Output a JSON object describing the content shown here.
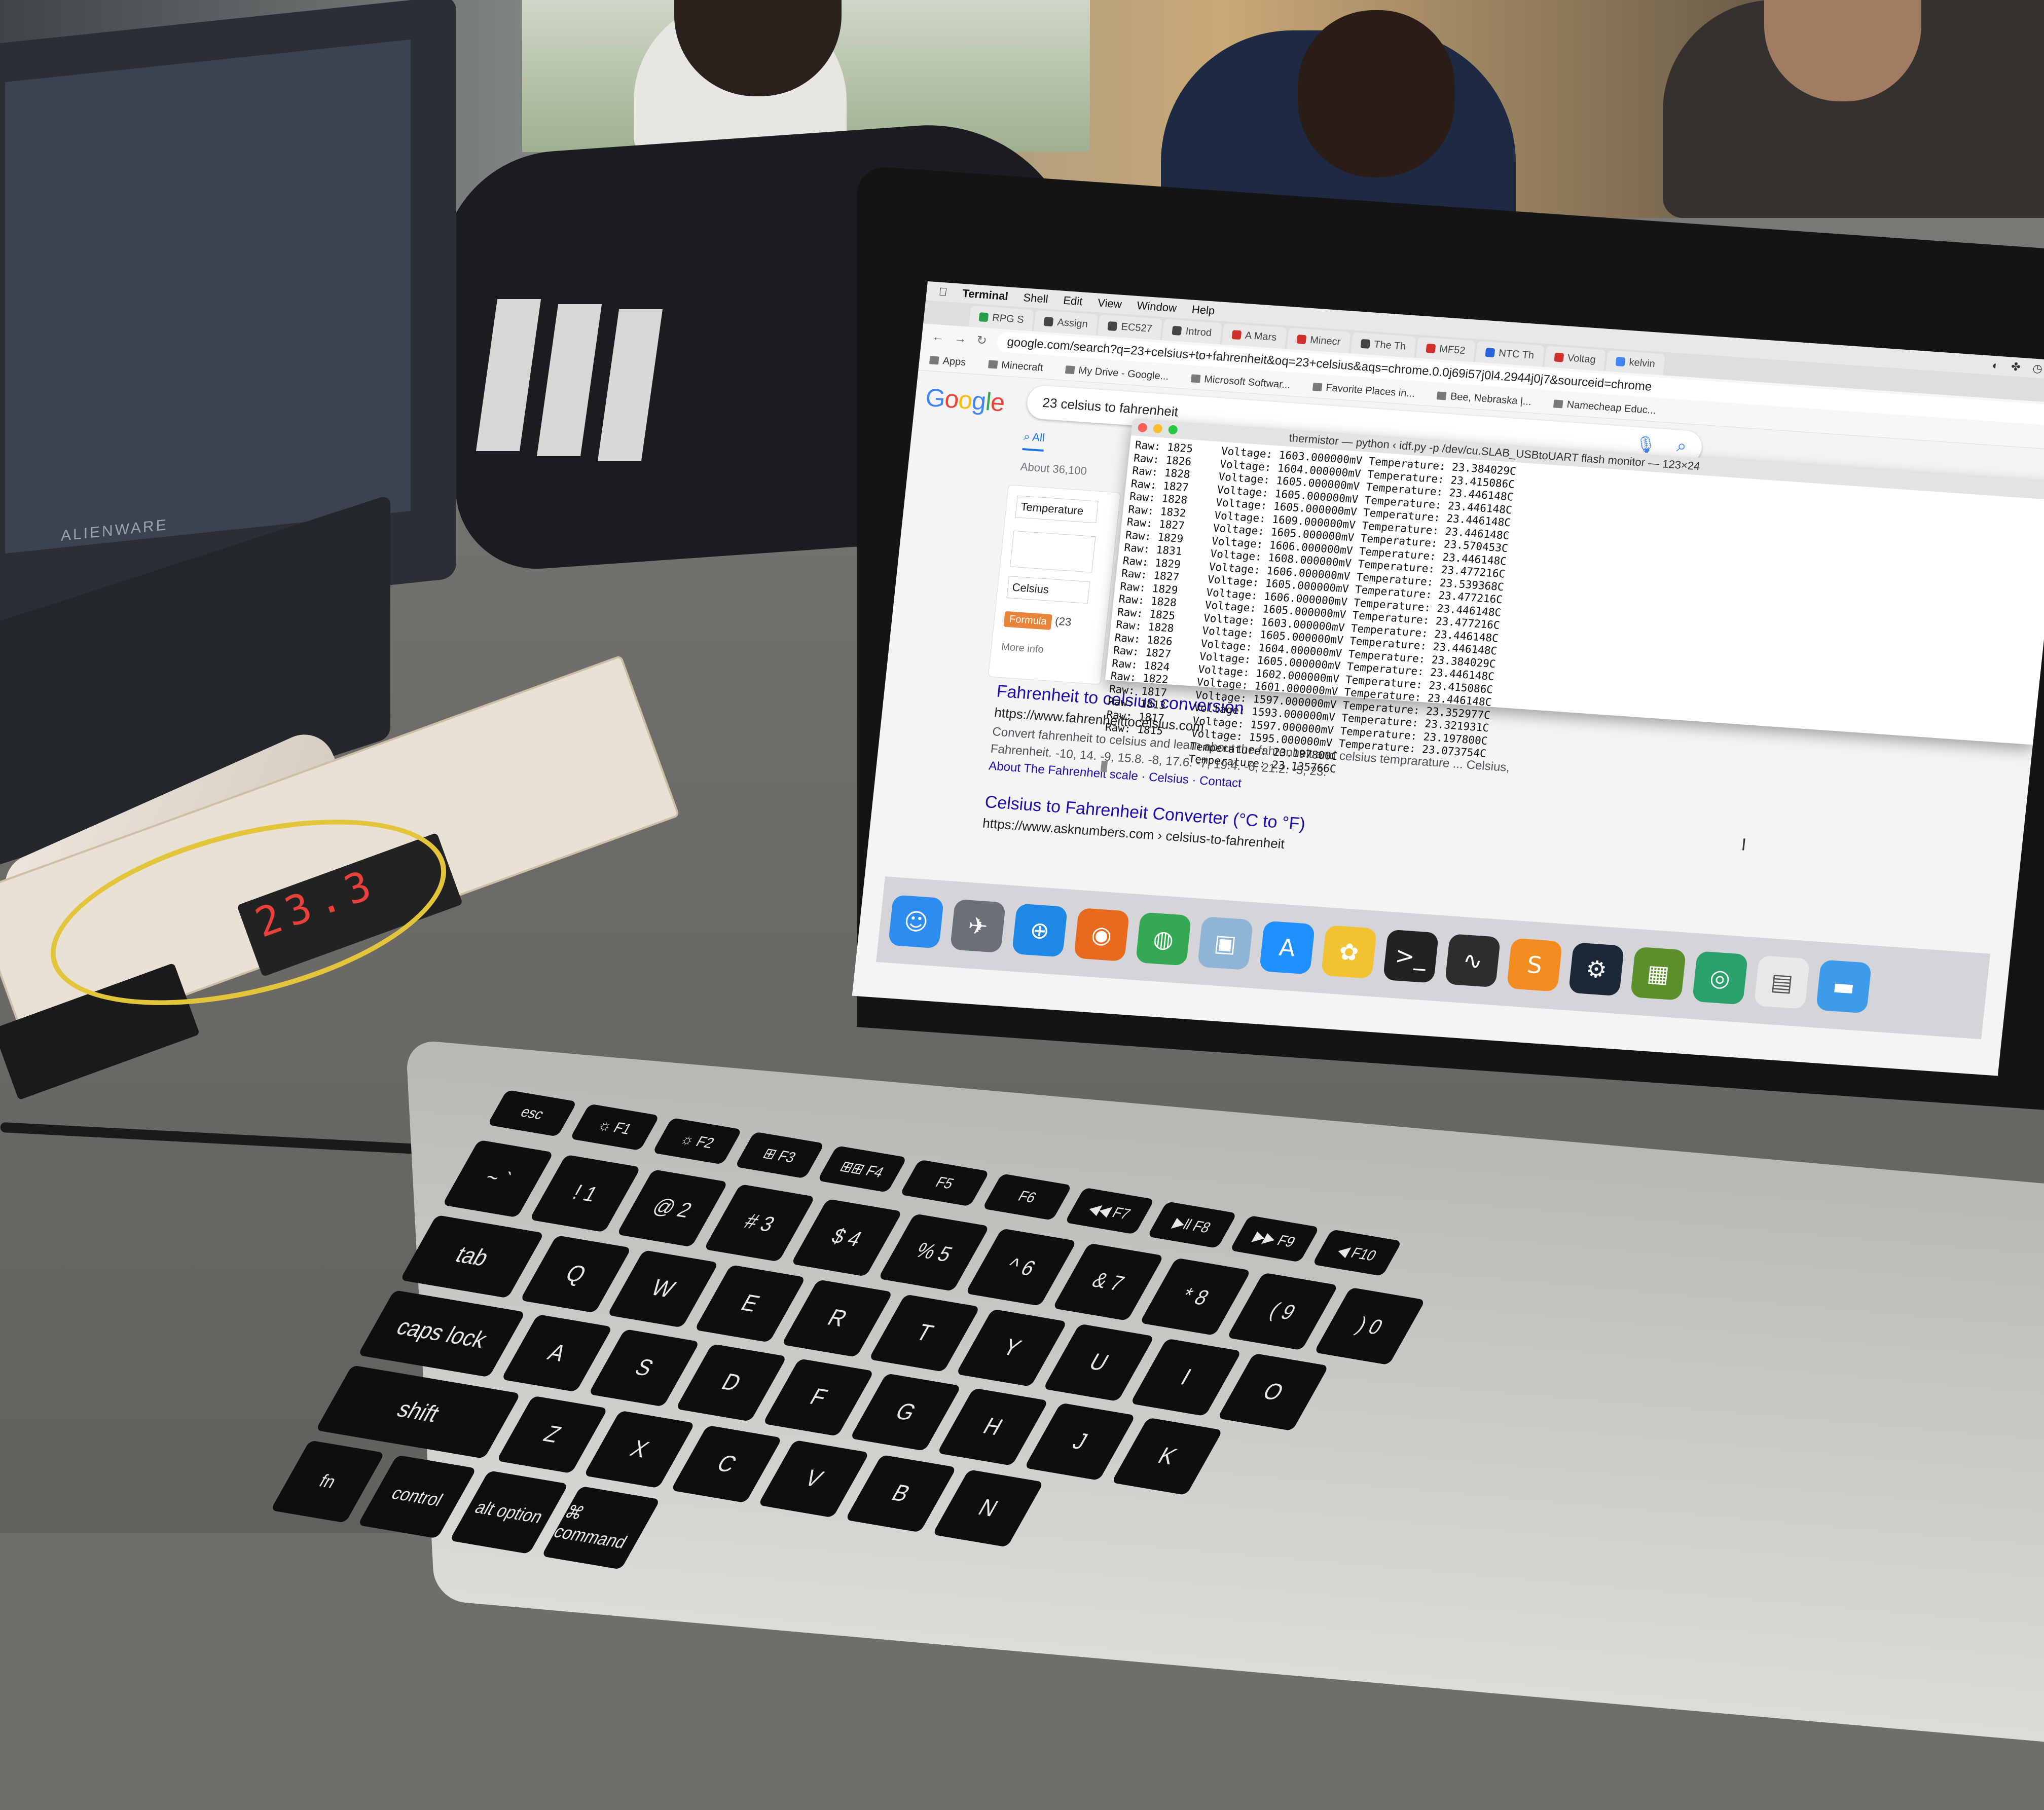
{
  "colors": {
    "accent": "#1a73e8",
    "link": "#1a0dab",
    "display_led": "#e8413b",
    "formula_badge": "#e8853a"
  },
  "alienware": {
    "logo_text": "ALIENWARE"
  },
  "breadboard_display": {
    "digits": "23.3"
  },
  "mac": {
    "menubar": {
      "apple_icon": "apple-icon",
      "items": [
        "Terminal",
        "Shell",
        "Edit",
        "View",
        "Window",
        "Help"
      ]
    },
    "tabs": [
      {
        "label": "RPG S",
        "color": "#2a9d4b"
      },
      {
        "label": "Assign",
        "color": "#444444"
      },
      {
        "label": "EC527",
        "color": "#444444"
      },
      {
        "label": "Introd",
        "color": "#444444"
      },
      {
        "label": "A Mars",
        "color": "#d0312d"
      },
      {
        "label": "Minecr",
        "color": "#d0312d"
      },
      {
        "label": "The Th",
        "color": "#444444"
      },
      {
        "label": "MF52",
        "color": "#d0312d"
      },
      {
        "label": "NTC Th",
        "color": "#2962d8"
      },
      {
        "label": "Voltag",
        "color": "#d0312d"
      },
      {
        "label": "kelvin",
        "color": "#4285f4"
      }
    ],
    "address": {
      "url": "google.com/search?q=23+celsius+to+fahrenheit&oq=23+celsius&aqs=chrome.0.0j69i57j0l4.2944j0j7&sourceid=chrome"
    },
    "bookmarks": [
      "Apps",
      "Minecraft",
      "My Drive - Google...",
      "Microsoft Softwar...",
      "Favorite Places in...",
      "Bee, Nebraska |...",
      "Namecheap Educ..."
    ],
    "google": {
      "logo": [
        "G",
        "o",
        "o",
        "g",
        "l",
        "e"
      ],
      "query": "23 celsius to fahrenheit",
      "tab_all": "All",
      "stats": "About 36,100",
      "converter": {
        "temperature_label": "Temperature",
        "celsius_label": "Celsius",
        "formula_label": "Formula",
        "formula_value": "(23",
        "more_info": "More info"
      },
      "results": [
        {
          "title": "Fahrenheit to celsius conversion",
          "url": "https://www.fahrenheittocelsius.com",
          "snippet_1": "Convert fahrenheit to celsius and learn about the fahrenheit and celsius temprarature ... Celsius,",
          "snippet_2": "Fahrenheit. -10, 14. -9, 15.8. -8, 17.6. -7, 19.4. -6, 21.2. -5, 23.",
          "links": "About The Fahrenheit scale · Celsius · Contact"
        },
        {
          "title": "Celsius to Fahrenheit Converter (°C to °F)",
          "url": "https://www.asknumbers.com › celsius-to-fahrenheit"
        }
      ]
    },
    "terminal": {
      "title": "thermistor — python ‹ idf.py -p /dev/cu.SLAB_USBtoUART flash monitor — 123×24",
      "raw": [
        "1825",
        "1826",
        "1828",
        "1827",
        "1828",
        "1832",
        "1827",
        "1829",
        "1831",
        "1829",
        "1827",
        "1829",
        "1828",
        "1825",
        "1828",
        "1826",
        "1827",
        "1824",
        "1822",
        "1817",
        "1813",
        "1817",
        "1815"
      ],
      "readings": [
        {
          "voltage": "1603.000000",
          "temperature": "23.384029"
        },
        {
          "voltage": "1604.000000",
          "temperature": "23.415086"
        },
        {
          "voltage": "1605.000000",
          "temperature": "23.446148"
        },
        {
          "voltage": "1605.000000",
          "temperature": "23.446148"
        },
        {
          "voltage": "1605.000000",
          "temperature": "23.446148"
        },
        {
          "voltage": "1609.000000",
          "temperature": "23.446148"
        },
        {
          "voltage": "1605.000000",
          "temperature": "23.570453"
        },
        {
          "voltage": "1606.000000",
          "temperature": "23.446148"
        },
        {
          "voltage": "1608.000000",
          "temperature": "23.477216"
        },
        {
          "voltage": "1606.000000",
          "temperature": "23.539368"
        },
        {
          "voltage": "1605.000000",
          "temperature": "23.477216"
        },
        {
          "voltage": "1606.000000",
          "temperature": "23.446148"
        },
        {
          "voltage": "1605.000000",
          "temperature": "23.477216"
        },
        {
          "voltage": "1603.000000",
          "temperature": "23.446148"
        },
        {
          "voltage": "1605.000000",
          "temperature": "23.446148"
        },
        {
          "voltage": "1604.000000",
          "temperature": "23.384029"
        },
        {
          "voltage": "1605.000000",
          "temperature": "23.446148"
        },
        {
          "voltage": "1602.000000",
          "temperature": "23.415086"
        },
        {
          "voltage": "1601.000000",
          "temperature": "23.446148"
        },
        {
          "voltage": "1597.000000",
          "temperature": "23.352977"
        },
        {
          "voltage": "1593.000000",
          "temperature": "23.321931"
        },
        {
          "voltage": "1597.000000",
          "temperature": "23.197800"
        },
        {
          "voltage": "1595.000000",
          "temperature": "23.073754"
        },
        {
          "voltage": "",
          "temperature": "23.197800"
        },
        {
          "voltage": "",
          "temperature": "23.135766"
        }
      ]
    },
    "dock": [
      {
        "name": "finder-icon",
        "glyph": "☺",
        "color": "#2d8cf0"
      },
      {
        "name": "launchpad-icon",
        "glyph": "✈",
        "color": "#6b6f78"
      },
      {
        "name": "safari-icon",
        "glyph": "⊕",
        "color": "#1e88e5"
      },
      {
        "name": "firefox-icon",
        "glyph": "◉",
        "color": "#e86a1f"
      },
      {
        "name": "chrome-icon",
        "glyph": "◍",
        "color": "#34a853"
      },
      {
        "name": "preview-icon",
        "glyph": "▣",
        "color": "#8fb5d6"
      },
      {
        "name": "app-store-icon",
        "glyph": "A",
        "color": "#1e90ff"
      },
      {
        "name": "photos-icon",
        "glyph": "✿",
        "color": "#f1c232"
      },
      {
        "name": "terminal-icon",
        "glyph": ">_",
        "color": "#222222"
      },
      {
        "name": "activity-monitor-icon",
        "glyph": "∿",
        "color": "#2d2d2d"
      },
      {
        "name": "sublime-text-icon",
        "glyph": "S",
        "color": "#f28b20"
      },
      {
        "name": "steam-icon",
        "glyph": "⚙",
        "color": "#1b2838"
      },
      {
        "name": "minecraft-icon",
        "glyph": "▦",
        "color": "#5a8f29"
      },
      {
        "name": "network-icon",
        "glyph": "◎",
        "color": "#2aa06a"
      },
      {
        "name": "document-icon",
        "glyph": "▤",
        "color": "#e9e9e9"
      },
      {
        "name": "folder-icon",
        "glyph": "▬",
        "color": "#3d9be9"
      }
    ],
    "keyboard": {
      "row_fn": [
        "esc",
        "☼ F1",
        "☼ F2",
        "⊞ F3",
        "⊞⊞ F4",
        "F5",
        "F6",
        "◀◀ F7",
        "▶ll F8",
        "▶▶ F9",
        "◀ F10"
      ],
      "row_num": [
        "~ `",
        "! 1",
        "@ 2",
        "# 3",
        "$ 4",
        "% 5",
        "^ 6",
        "& 7",
        "* 8",
        "( 9",
        ") 0"
      ],
      "row_q": [
        "tab",
        "Q",
        "W",
        "E",
        "R",
        "T",
        "Y",
        "U",
        "I",
        "O"
      ],
      "row_a": [
        "caps lock",
        "A",
        "S",
        "D",
        "F",
        "G",
        "H",
        "J",
        "K"
      ],
      "row_z": [
        "shift",
        "Z",
        "X",
        "C",
        "V",
        "B",
        "N"
      ],
      "row_bottom": [
        "fn",
        "control",
        "alt option",
        "⌘ command"
      ]
    }
  }
}
